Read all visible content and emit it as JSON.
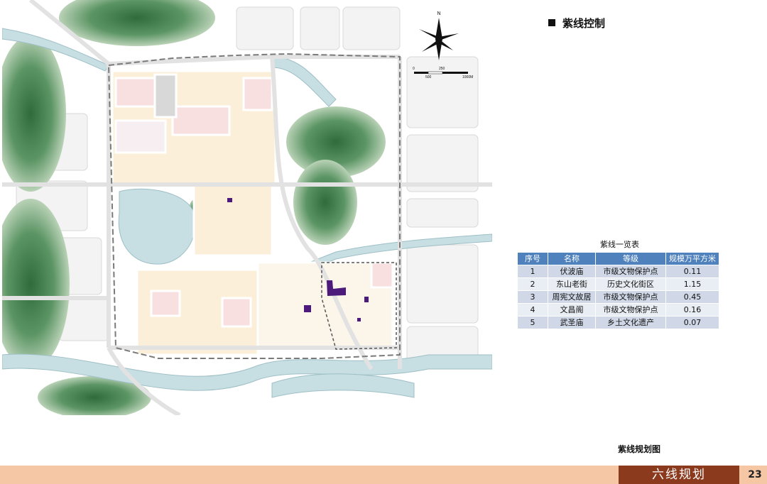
{
  "section_title": "紫线控制",
  "table": {
    "caption": "紫线一览表",
    "headers": [
      "序号",
      "名称",
      "等级",
      "规模万平方米"
    ],
    "rows": [
      {
        "no": "1",
        "name": "伏波庙",
        "level": "市级文物保护点",
        "size": "0.11"
      },
      {
        "no": "2",
        "name": "东山老街",
        "level": "历史文化街区",
        "size": "1.15"
      },
      {
        "no": "3",
        "name": "周宪文故居",
        "level": "市级文物保护点",
        "size": "0.45"
      },
      {
        "no": "4",
        "name": "文昌阁",
        "level": "市级文物保护点",
        "size": "0.16"
      },
      {
        "no": "5",
        "name": "武圣庙",
        "level": "乡土文化遗产",
        "size": "0.07"
      }
    ]
  },
  "map": {
    "caption": "紫线规划图",
    "north_label": "N",
    "scale_labels": [
      "0",
      "250",
      "500",
      "1000M"
    ],
    "colors": {
      "background": "#ffffff",
      "water": "#c7dfe3",
      "mountain": "#4f8a5a",
      "block_residential": "#fbefd9",
      "block_commercial": "#f8dfe0",
      "purple_line": "#4b1a7a",
      "road": "#ffffff",
      "boundary": "#7a7a7a"
    }
  },
  "footer": {
    "chapter": "六线规划",
    "page": "23",
    "bar_color": "#f6c7a4",
    "dark_color": "#8b3a1e"
  }
}
